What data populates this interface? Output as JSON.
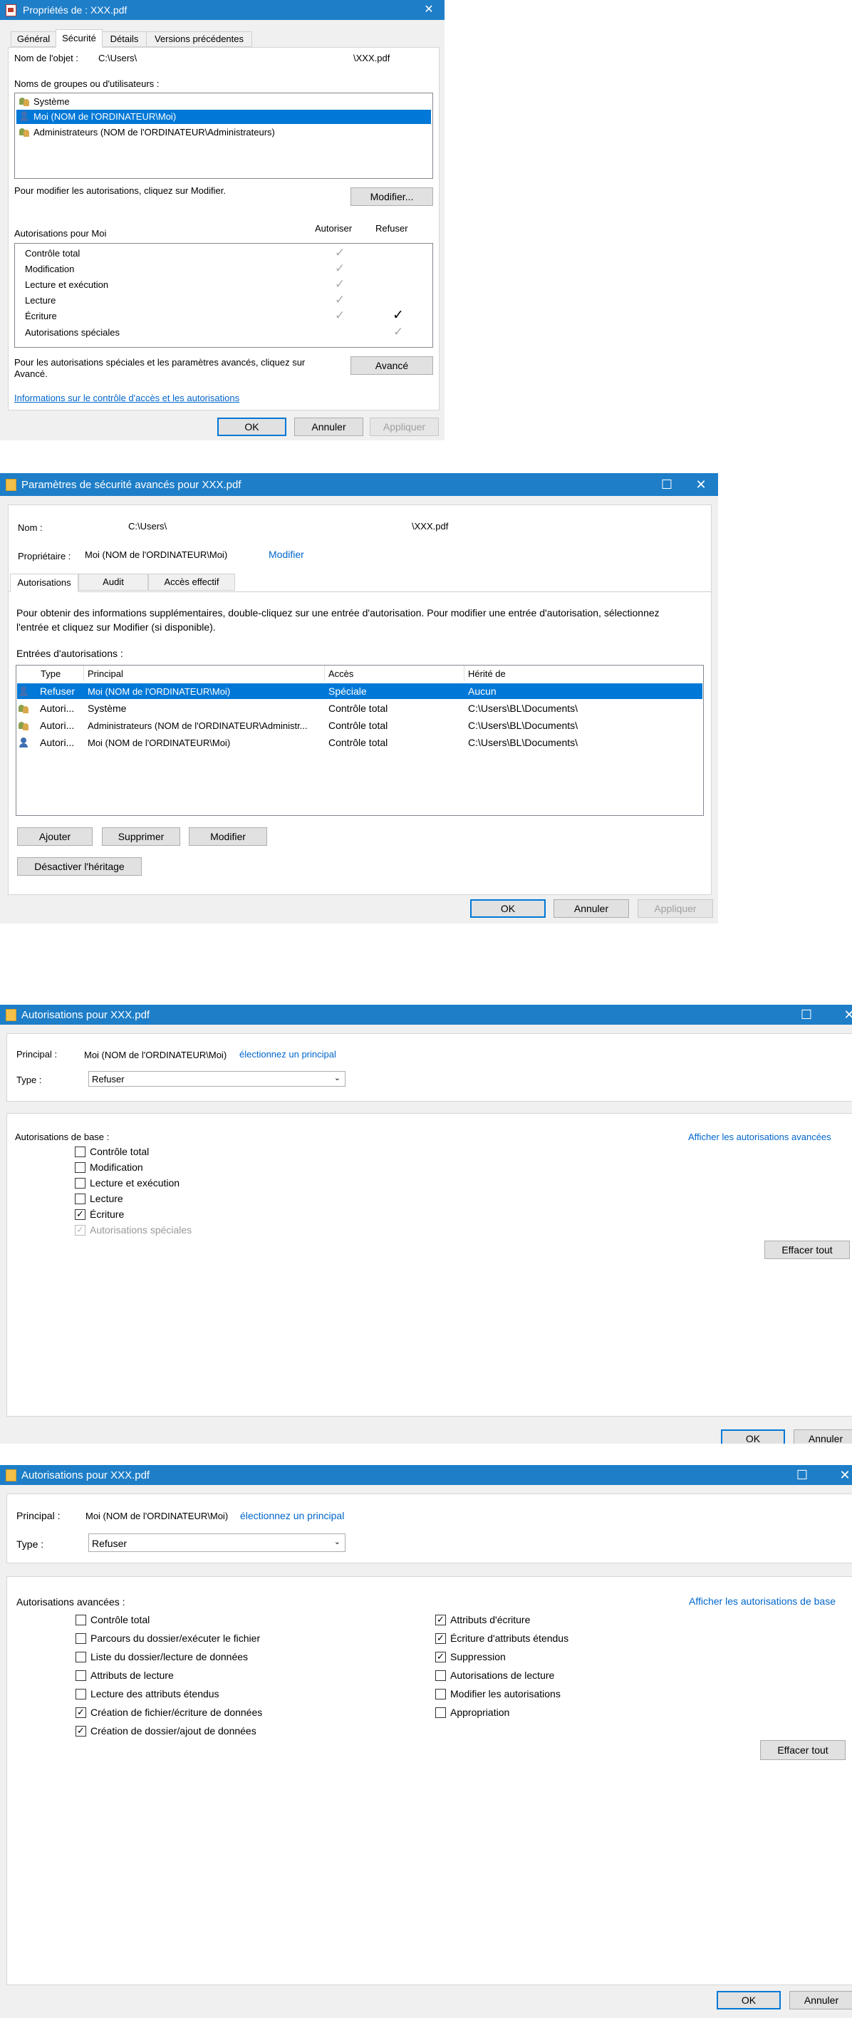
{
  "dlg1": {
    "title": "Propriétés de : XXX.pdf",
    "close": "✕",
    "tabs": [
      "Général",
      "Sécurité",
      "Détails",
      "Versions précédentes"
    ],
    "object_label": "Nom de l'objet :",
    "object_path_start": "C:\\Users\\",
    "object_path_end": "\\XXX.pdf",
    "groups_label": "Noms de groupes ou d'utilisateurs :",
    "groups": [
      "Système",
      "Moi (NOM de l'ORDINATEUR\\Moi)",
      "Administrateurs (NOM de l'ORDINATEUR\\Administrateurs)"
    ],
    "modify_hint": "Pour modifier les autorisations, cliquez sur Modifier.",
    "modify_button": "Modifier...",
    "perm_label": "Autorisations pour Moi",
    "allow_header": "Autoriser",
    "deny_header": "Refuser",
    "permissions": [
      "Contrôle total",
      "Modification",
      "Lecture et exécution",
      "Lecture",
      "Écriture",
      "Autorisations spéciales"
    ],
    "advanced_hint": "Pour les autorisations spéciales et les paramètres avancés, cliquez sur Avancé.",
    "advanced_button": "Avancé",
    "info_link": "Informations sur le contrôle d'accès et les autorisations",
    "ok": "OK",
    "cancel": "Annuler",
    "apply": "Appliquer"
  },
  "dlg2": {
    "title": "Paramètres de sécurité avancés pour XXX.pdf",
    "min": "—",
    "max": "☐",
    "close": "✕",
    "name_label": "Nom :",
    "name_start": "C:\\Users\\",
    "name_end": "\\XXX.pdf",
    "owner_label": "Propriétaire :",
    "owner_value": "Moi (NOM de l'ORDINATEUR\\Moi)",
    "owner_modify": "Modifier",
    "tabs": [
      "Autorisations",
      "Audit",
      "Accès effectif"
    ],
    "info": "Pour obtenir des informations supplémentaires, double-cliquez sur une entrée d'autorisation. Pour modifier une entrée d'autorisation, sélectionnez l'entrée et cliquez sur Modifier (si disponible).",
    "entries_label": "Entrées d'autorisations :",
    "columns": [
      "Type",
      "Principal",
      "Accès",
      "Hérité de"
    ],
    "entries": [
      [
        "Refuser",
        "Moi (NOM de l'ORDINATEUR\\Moi)",
        "Spéciale",
        "Aucun"
      ],
      [
        "Autori...",
        "Système",
        "Contrôle total",
        "C:\\Users\\BL\\Documents\\"
      ],
      [
        "Autori...",
        "Administrateurs (NOM de l'ORDINATEUR\\Administr...",
        "Contrôle total",
        "C:\\Users\\BL\\Documents\\"
      ],
      [
        "Autori...",
        "Moi (NOM de l'ORDINATEUR\\Moi)",
        "Contrôle total",
        "C:\\Users\\BL\\Documents\\"
      ]
    ],
    "add": "Ajouter",
    "remove": "Supprimer",
    "modify": "Modifier",
    "disable_inheritance": "Désactiver l'héritage",
    "ok": "OK",
    "cancel": "Annuler",
    "apply": "Appliquer"
  },
  "dlg3": {
    "title": "Autorisations pour XXX.pdf",
    "principal_label": "Principal :",
    "principal_value": "Moi (NOM de l'ORDINATEUR\\Moi)",
    "select_principal": "électionnez un principal",
    "type_label": "Type :",
    "type_value": "Refuser",
    "basic_label": "Autorisations de base :",
    "show_advanced": "Afficher les autorisations avancées",
    "permissions": [
      "Contrôle total",
      "Modification",
      "Lecture et exécution",
      "Lecture",
      "Écriture",
      "Autorisations spéciales"
    ],
    "checked": [
      false,
      false,
      false,
      false,
      true,
      true
    ],
    "clear_all": "Effacer tout",
    "ok": "OK",
    "cancel": "Annuler"
  },
  "dlg4": {
    "title": "Autorisations pour XXX.pdf",
    "principal_label": "Principal :",
    "principal_value": "Moi (NOM de l'ORDINATEUR\\Moi)",
    "select_principal": "électionnez un principal",
    "type_label": "Type :",
    "type_value": "Refuser",
    "advanced_label": "Autorisations avancées :",
    "show_basic": "Afficher les autorisations de base",
    "left_perms": [
      "Contrôle total",
      "Parcours du dossier/exécuter le fichier",
      "Liste du dossier/lecture de données",
      "Attributs de lecture",
      "Lecture des attributs étendus",
      "Création de fichier/écriture de données",
      "Création de dossier/ajout de données"
    ],
    "left_checked": [
      false,
      false,
      false,
      false,
      false,
      true,
      true
    ],
    "right_perms": [
      "Attributs d'écriture",
      "Écriture d'attributs étendus",
      "Suppression",
      "Autorisations de lecture",
      "Modifier les autorisations",
      "Appropriation"
    ],
    "right_checked": [
      true,
      true,
      true,
      false,
      false,
      false
    ],
    "clear_all": "Effacer tout",
    "ok": "OK",
    "cancel": "Annuler"
  }
}
